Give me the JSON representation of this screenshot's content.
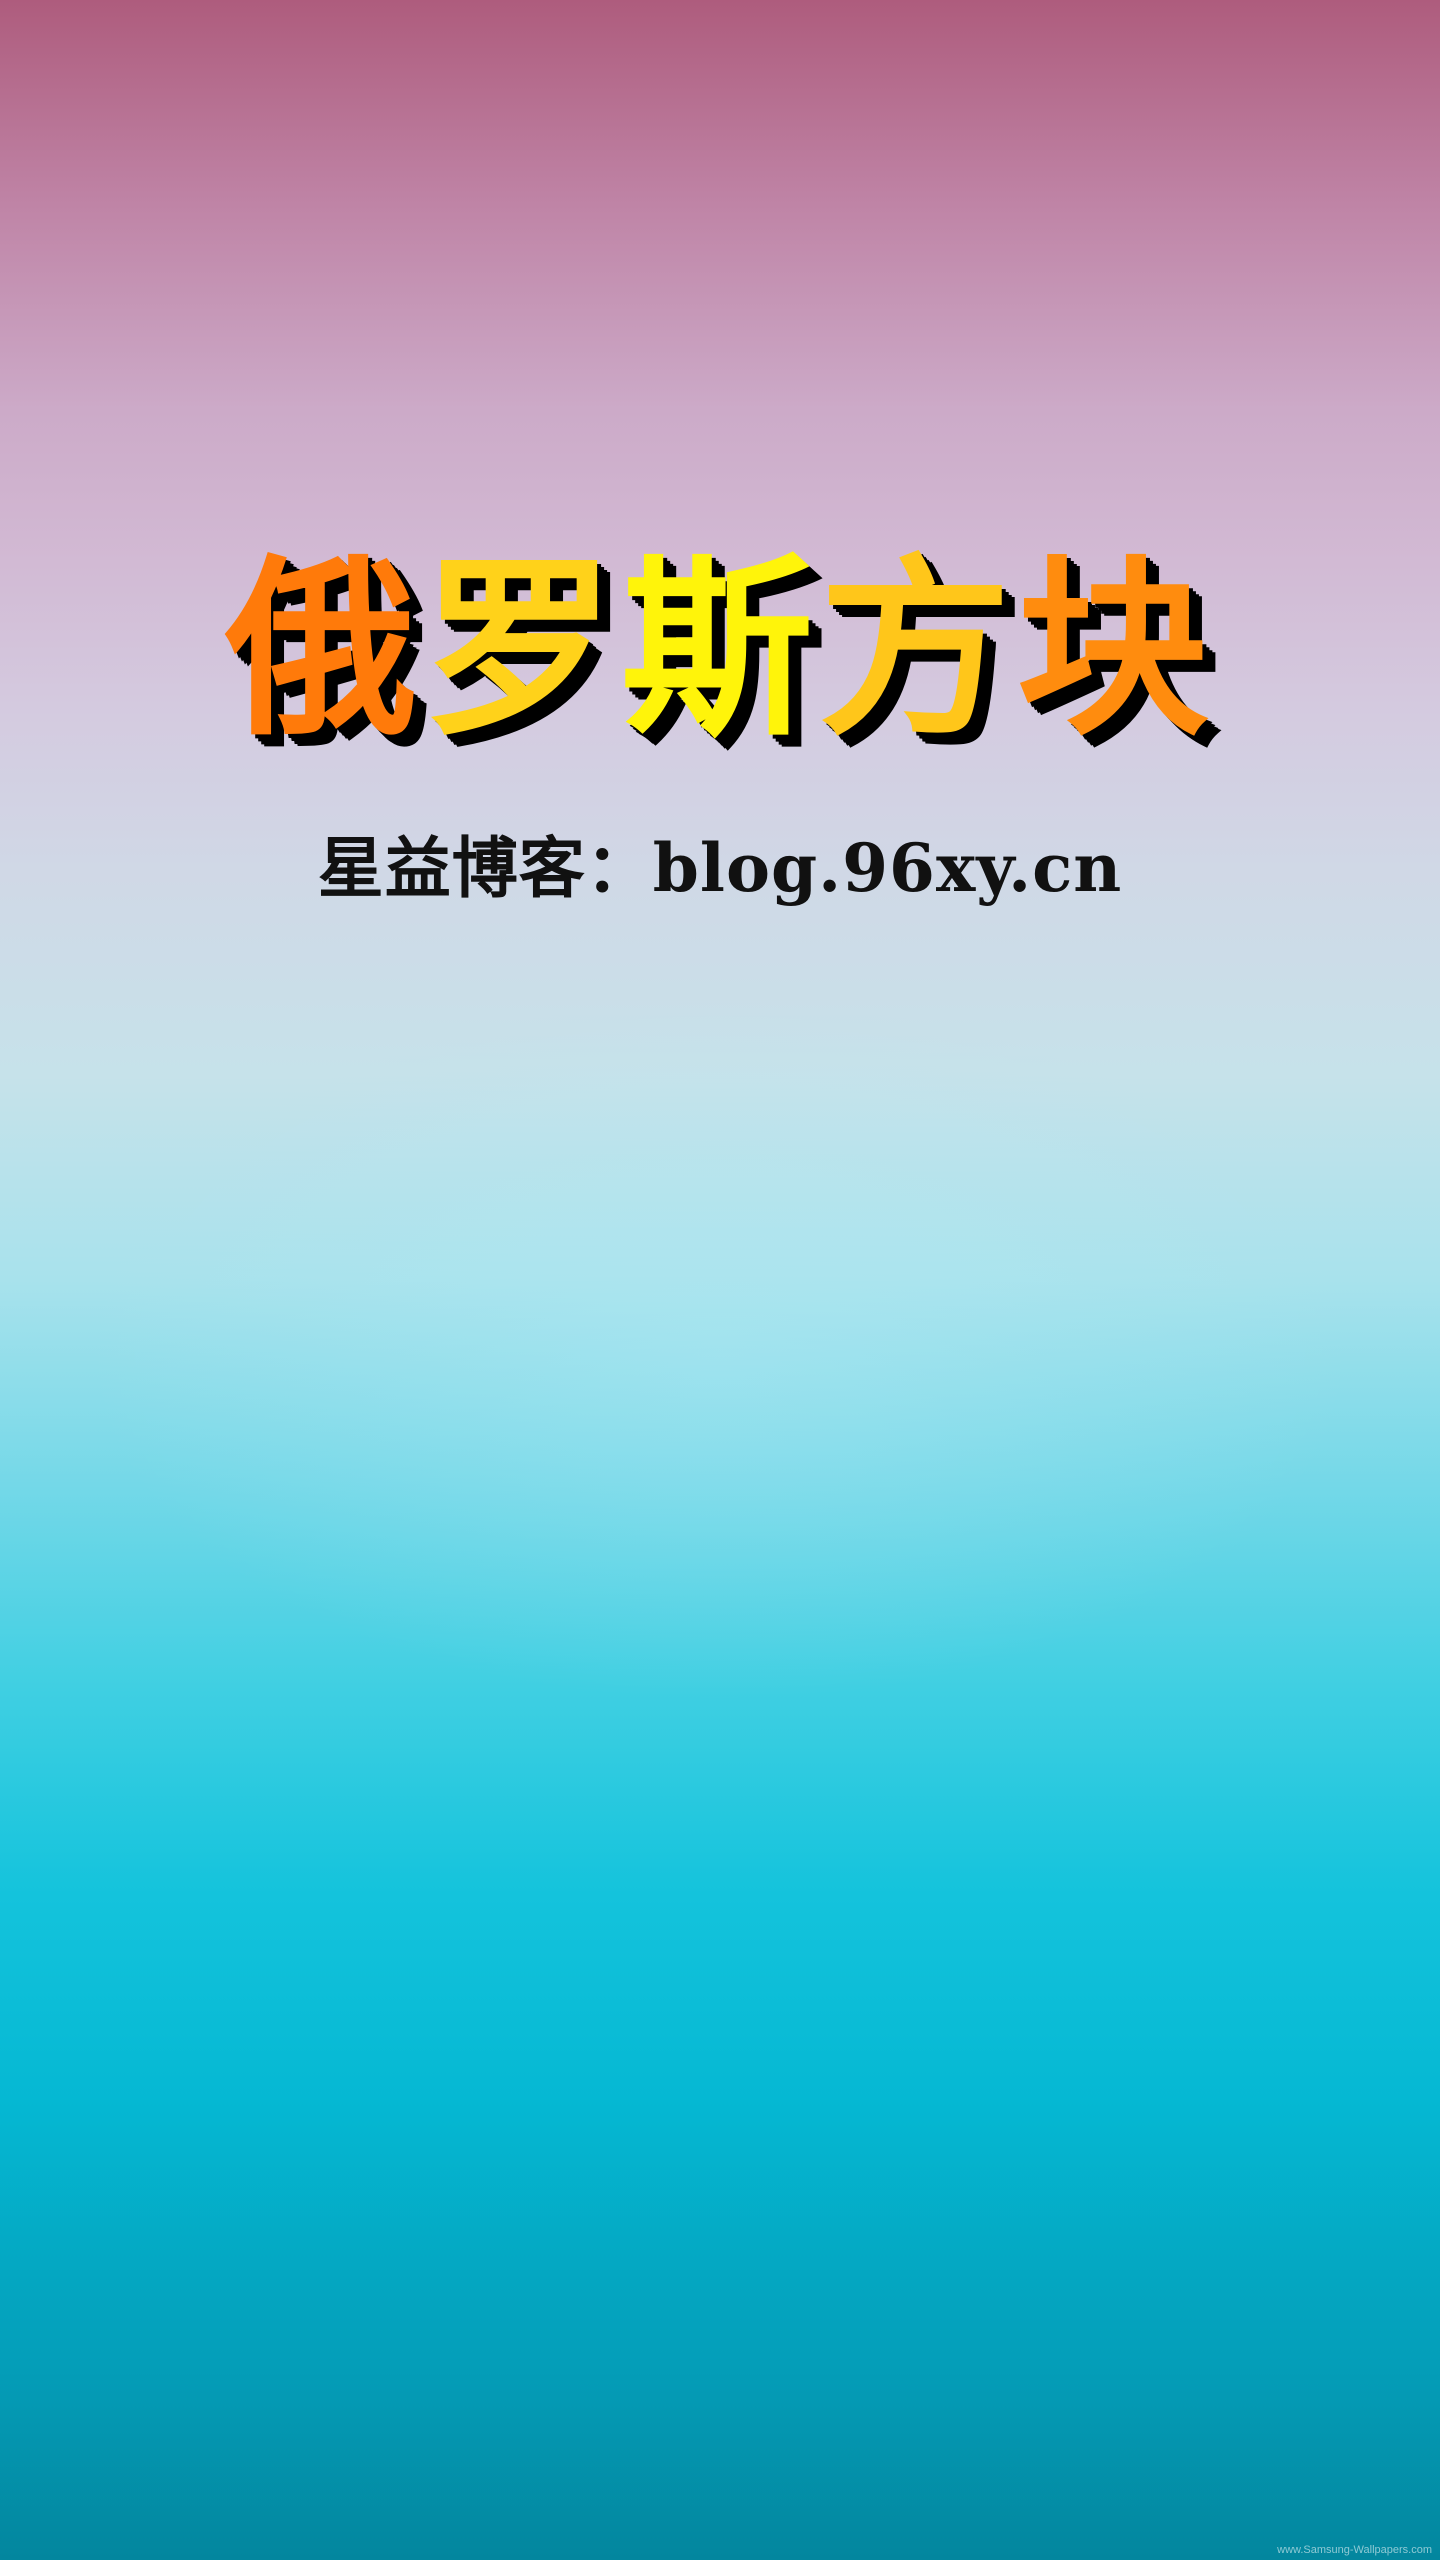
{
  "title": {
    "chars": [
      "俄",
      "罗",
      "斯",
      "方",
      "块"
    ],
    "colors": [
      "#ff7a0a",
      "#ffd21a",
      "#fff40a",
      "#ffc61a",
      "#ff8c0e"
    ],
    "shadow_color": "#000000"
  },
  "subtitle": "星益博客：blog.96xy.cn",
  "watermark": "www.Samsung-Wallpapers.com",
  "background": {
    "top_color": "#ae5c7d",
    "middle_color": "#d0d8e6",
    "bottom_color": "#03869e"
  }
}
